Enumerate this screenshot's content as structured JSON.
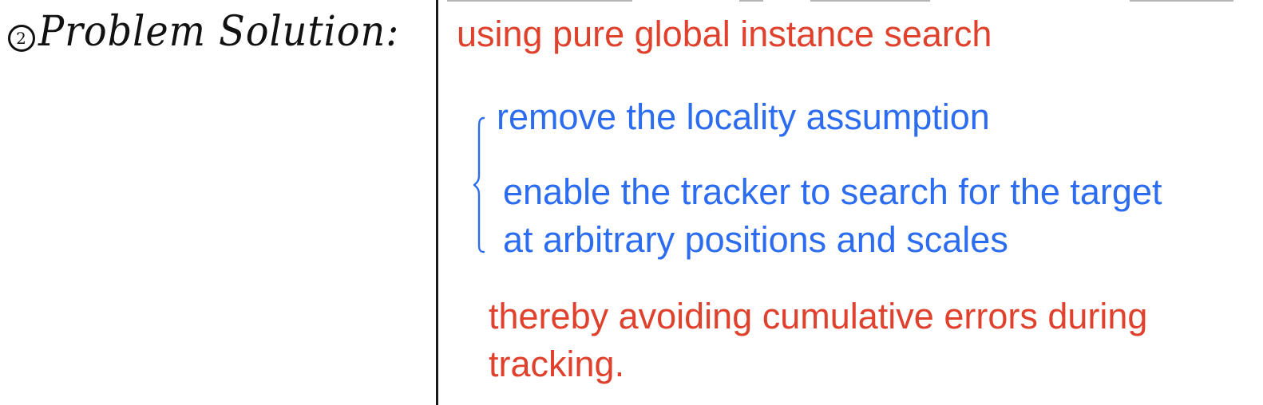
{
  "heading": {
    "number": "2",
    "text": "Problem Solution:"
  },
  "content": {
    "line1": "using pure global instance search",
    "line2": "remove the locality assumption",
    "line3": "enable the tracker to search for the target",
    "line4": "at arbitrary positions and scales",
    "line5": "thereby avoiding cumulative errors during",
    "line6": "tracking."
  },
  "colors": {
    "red_text": "#e0412c",
    "blue_text": "#2b6cf0",
    "ink": "#111111"
  }
}
